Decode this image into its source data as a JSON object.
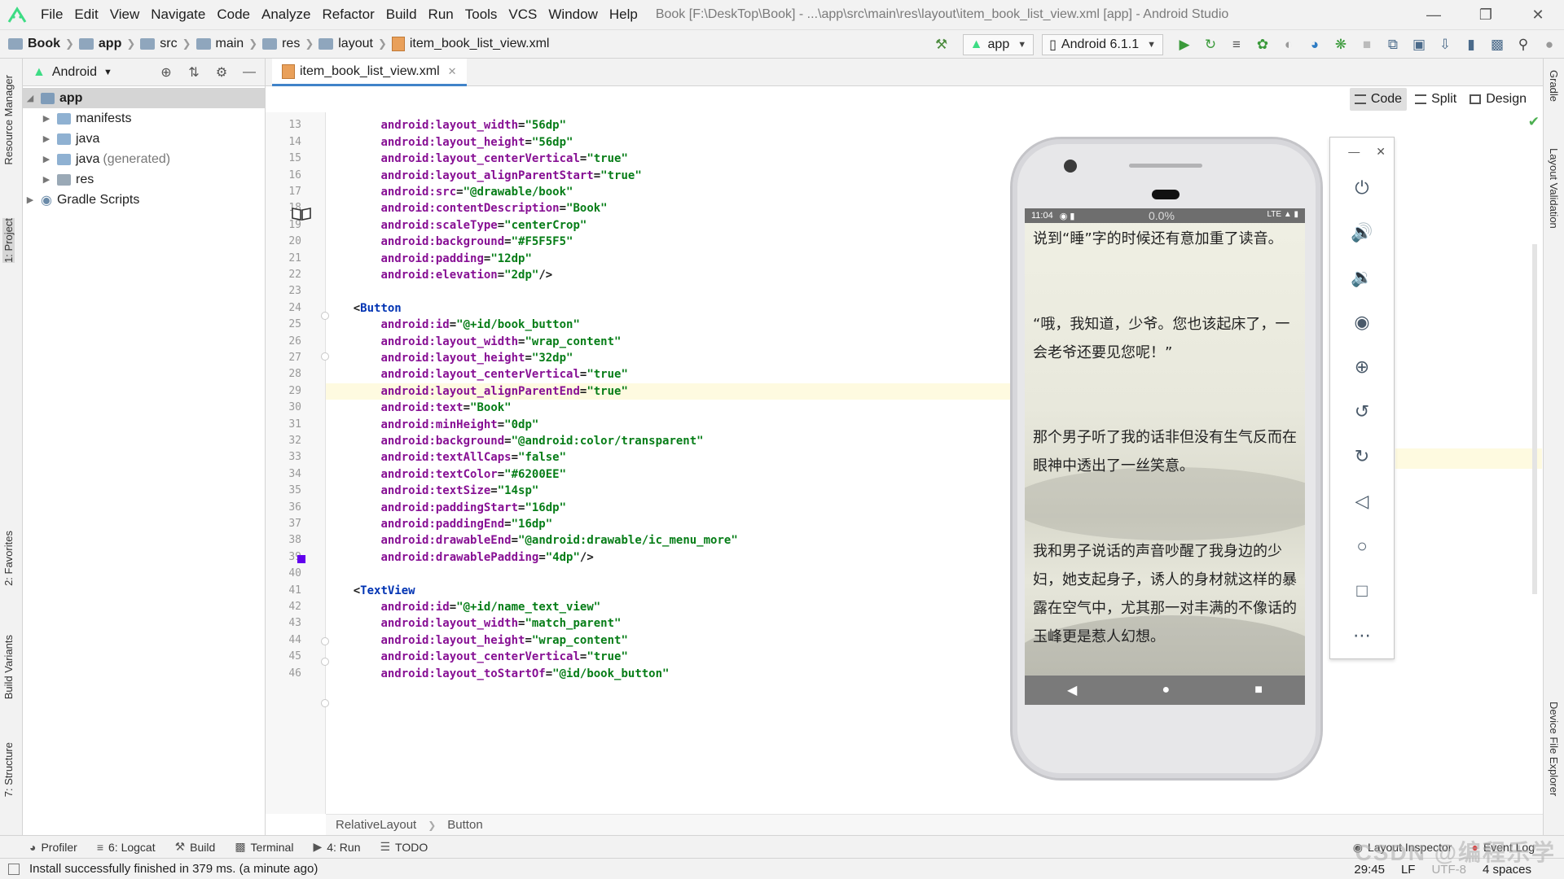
{
  "menubar": {
    "items": [
      "File",
      "Edit",
      "View",
      "Navigate",
      "Code",
      "Analyze",
      "Refactor",
      "Build",
      "Run",
      "Tools",
      "VCS",
      "Window",
      "Help"
    ],
    "title": "Book [F:\\DeskTop\\Book] - ...\\app\\src\\main\\res\\layout\\item_book_list_view.xml [app] - Android Studio"
  },
  "navbar": {
    "crumbs": [
      "Book",
      "app",
      "src",
      "main",
      "res",
      "layout"
    ],
    "file": "item_book_list_view.xml",
    "run_config": "app",
    "device": "Android 6.1.1"
  },
  "project": {
    "view_mode": "Android",
    "tree": [
      {
        "label": "app",
        "level": 0,
        "expanded": true
      },
      {
        "label": "manifests",
        "level": 1
      },
      {
        "label": "java",
        "level": 1
      },
      {
        "label": "java",
        "suffix": "(generated)",
        "level": 1
      },
      {
        "label": "res",
        "level": 1
      },
      {
        "label": "Gradle Scripts",
        "level": 0
      }
    ]
  },
  "left_tabs": [
    "Resource Manager",
    "1: Project",
    "2: Favorites",
    "Build Variants",
    "7: Structure"
  ],
  "right_tabs": [
    "Gradle",
    "Layout Validation",
    "Device File Explorer"
  ],
  "editor": {
    "tab": "item_book_list_view.xml",
    "view_modes": [
      "Code",
      "Split",
      "Design"
    ],
    "active_mode": "Code",
    "highlight_line": 29,
    "lines": [
      {
        "n": 13,
        "indent": 8,
        "attr": "android:layout_width",
        "val": "\"56dp\""
      },
      {
        "n": 14,
        "indent": 8,
        "attr": "android:layout_height",
        "val": "\"56dp\""
      },
      {
        "n": 15,
        "indent": 8,
        "attr": "android:layout_centerVertical",
        "val": "\"true\""
      },
      {
        "n": 16,
        "indent": 8,
        "attr": "android:layout_alignParentStart",
        "val": "\"true\""
      },
      {
        "n": 17,
        "indent": 8,
        "attr": "android:src",
        "val": "\"@drawable/book\""
      },
      {
        "n": 18,
        "indent": 8,
        "attr": "android:contentDescription",
        "val": "\"Book\""
      },
      {
        "n": 19,
        "indent": 8,
        "attr": "android:scaleType",
        "val": "\"centerCrop\""
      },
      {
        "n": 20,
        "indent": 8,
        "attr": "android:background",
        "val": "\"#F5F5F5\""
      },
      {
        "n": 21,
        "indent": 8,
        "attr": "android:padding",
        "val": "\"12dp\""
      },
      {
        "n": 22,
        "indent": 8,
        "attr": "android:elevation",
        "val": "\"2dp\"",
        "tail": "/>"
      },
      {
        "n": 23,
        "indent": 0
      },
      {
        "n": 24,
        "indent": 4,
        "tag": "<Button"
      },
      {
        "n": 25,
        "indent": 8,
        "attr": "android:id",
        "val": "\"@+id/book_button\""
      },
      {
        "n": 26,
        "indent": 8,
        "attr": "android:layout_width",
        "val": "\"wrap_content\""
      },
      {
        "n": 27,
        "indent": 8,
        "attr": "android:layout_height",
        "val": "\"32dp\""
      },
      {
        "n": 28,
        "indent": 8,
        "attr": "android:layout_centerVertical",
        "val": "\"true\""
      },
      {
        "n": 29,
        "indent": 8,
        "attr": "android:layout_alignParentEnd",
        "val": "\"true\""
      },
      {
        "n": 30,
        "indent": 8,
        "attr": "android:text",
        "val": "\"Book\""
      },
      {
        "n": 31,
        "indent": 8,
        "attr": "android:minHeight",
        "val": "\"0dp\""
      },
      {
        "n": 32,
        "indent": 8,
        "attr": "android:background",
        "val": "\"@android:color/transparent\""
      },
      {
        "n": 33,
        "indent": 8,
        "attr": "android:textAllCaps",
        "val": "\"false\""
      },
      {
        "n": 34,
        "indent": 8,
        "attr": "android:textColor",
        "val": "\"#6200EE\""
      },
      {
        "n": 35,
        "indent": 8,
        "attr": "android:textSize",
        "val": "\"14sp\""
      },
      {
        "n": 36,
        "indent": 8,
        "attr": "android:paddingStart",
        "val": "\"16dp\""
      },
      {
        "n": 37,
        "indent": 8,
        "attr": "android:paddingEnd",
        "val": "\"16dp\""
      },
      {
        "n": 38,
        "indent": 8,
        "attr": "android:drawableEnd",
        "val": "\"@android:drawable/ic_menu_more\""
      },
      {
        "n": 39,
        "indent": 8,
        "attr": "android:drawablePadding",
        "val": "\"4dp\"",
        "tail": "/>"
      },
      {
        "n": 40,
        "indent": 0
      },
      {
        "n": 41,
        "indent": 4,
        "tag": "<TextView"
      },
      {
        "n": 42,
        "indent": 8,
        "attr": "android:id",
        "val": "\"@+id/name_text_view\""
      },
      {
        "n": 43,
        "indent": 8,
        "attr": "android:layout_width",
        "val": "\"match_parent\""
      },
      {
        "n": 44,
        "indent": 8,
        "attr": "android:layout_height",
        "val": "\"wrap_content\""
      },
      {
        "n": 45,
        "indent": 8,
        "attr": "android:layout_centerVertical",
        "val": "\"true\""
      },
      {
        "n": 46,
        "indent": 8,
        "attr": "android:layout_toStartOf",
        "val": "\"@id/book_button\""
      }
    ],
    "breadcrumbs": [
      "RelativeLayout",
      "Button"
    ]
  },
  "emulator": {
    "time": "11:04",
    "progress": "0.0%",
    "paragraphs": [
      "说到“睡”字的时候还有意加重了读音。",
      "“哦，我知道，少爷。您也该起床了，一会老爷还要见您呢！”",
      "那个男子听了我的话非但没有生气反而在眼神中透出了一丝笑意。",
      "我和男子说话的声音吵醒了我身边的少妇，她支起身子，诱人的身材就这样的暴露在空气中，尤其那一对丰满的不像话的玉峰更是惹人幻想。"
    ]
  },
  "bottom_tools": {
    "left": [
      "Profiler",
      "6: Logcat",
      "Build",
      "Terminal",
      "4: Run",
      "TODO"
    ],
    "right": [
      "Layout Inspector",
      "Event Log"
    ]
  },
  "status": {
    "message": "Install successfully finished in 379 ms. (a minute ago)",
    "position": "29:45",
    "line_sep": "LF",
    "encoding": "UTF-8",
    "indent": "4 spaces",
    "watermark": "CSDN @编程乐学"
  },
  "colors": {
    "attr": "#871094",
    "value": "#067d17",
    "tag": "#0033b3",
    "swatch": "#6200EE",
    "line_highlight": "#fefae0"
  }
}
